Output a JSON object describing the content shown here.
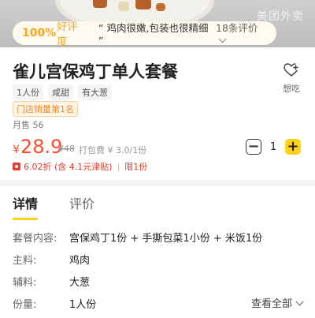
{
  "rating": {
    "percent": "100%",
    "label": "好评度",
    "quote": "“ 鸡肉很嫩,包装也很精细 ”",
    "count": "18条评价"
  },
  "watermark": "美团外卖",
  "product": {
    "title": "雀儿宫保鸡丁单人套餐",
    "wish_label": "想吃",
    "tags": [
      "1人份",
      "咸甜",
      "有大葱"
    ],
    "rank_badge": "门店销量第1名",
    "monthly_sales": "月售 56",
    "price_symbol": "¥",
    "price": "28.9",
    "original_price": "¥48",
    "packaging": "打包费 ¥ 3.0/1份",
    "quantity": "1",
    "discount_text": "6.02折 (含 4.1元津贴)",
    "limit_text": "限1份"
  },
  "tabs": [
    {
      "label": "详情",
      "active": true
    },
    {
      "label": "评价",
      "active": false
    }
  ],
  "details": [
    {
      "label": "套餐内容:",
      "value": "宫保鸡丁1份 + 手撕包菜1小份 + 米饭1份"
    },
    {
      "label": "主料:",
      "value": "鸡肉"
    },
    {
      "label": "辅料:",
      "value": "大葱"
    },
    {
      "label": "份量:",
      "value": "1人份"
    }
  ],
  "view_all_label": "查看全部",
  "colors": {
    "price": "#ff4a26",
    "accent_yellow": "#ffd21a",
    "rating_orange": "#f5a623",
    "discount_red": "#e53b2b"
  }
}
